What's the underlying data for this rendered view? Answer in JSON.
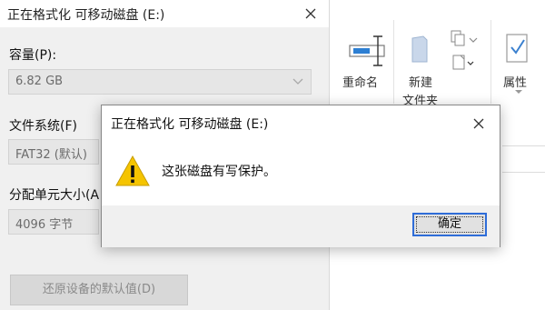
{
  "format_window": {
    "title": "正在格式化 可移动磁盘 (E:)",
    "capacity_label": "容量(P):",
    "capacity_value": "6.82 GB",
    "filesystem_label": "文件系统(F)",
    "filesystem_value": "FAT32 (默认)",
    "allocation_label": "分配单元大小(A",
    "allocation_value": "4096 字节",
    "restore_button": "还原设备的默认值(D)"
  },
  "ribbon": {
    "rename_label": "重命名",
    "new_folder_label_1": "新建",
    "new_folder_label_2": "文件夹",
    "properties_label": "属性"
  },
  "dialog": {
    "title": "正在格式化 可移动磁盘 (E:)",
    "message": "这张磁盘有写保护。",
    "ok_button": "确定"
  },
  "colors": {
    "warning": "#f5c400",
    "focus_border": "#2f6dd8"
  }
}
